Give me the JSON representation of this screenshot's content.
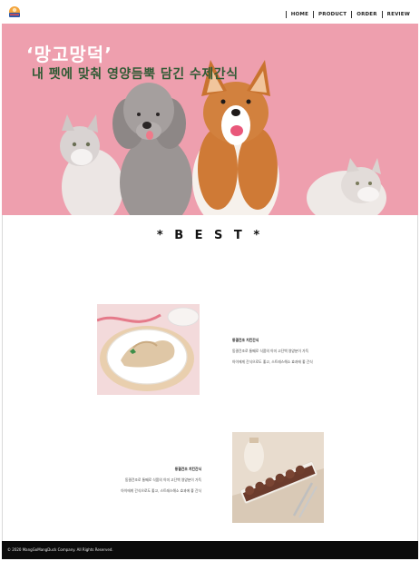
{
  "nav": {
    "items": [
      {
        "label": "HOME"
      },
      {
        "label": "PRODUCT"
      },
      {
        "label": "ORDER"
      },
      {
        "label": "REVIEW"
      }
    ]
  },
  "hero": {
    "quote_title": "‘망고망덕’",
    "subtitle": "내 펫에 맞춰 영양듬뿍 담긴 수제간식"
  },
  "best": {
    "title": "* B E S T *"
  },
  "products": [
    {
      "name": "동결건조 치킨간식",
      "desc1": "동결건조로 통째로 식품의 이미 고단백 영양분이 가득",
      "desc2": "아이에게 간식으로도 좋고, 스트레스해소 효과에 좋 간식"
    },
    {
      "name": "동결건조 치킨간식",
      "desc1": "동결건조로 통째로 식품의 이미 고단백 영양분이 가득",
      "desc2": "아이에게 간식으로도 좋고, 스트레스해소 효과에 좋 간식"
    }
  ],
  "footer": {
    "copyright": "© 2020 MangGoMangDuck Company. All Rights Reserved."
  },
  "colors": {
    "hero_bg": "#ee9fae",
    "hero_sub": "#2f5a34",
    "footer_bg": "#0b0b0b"
  }
}
